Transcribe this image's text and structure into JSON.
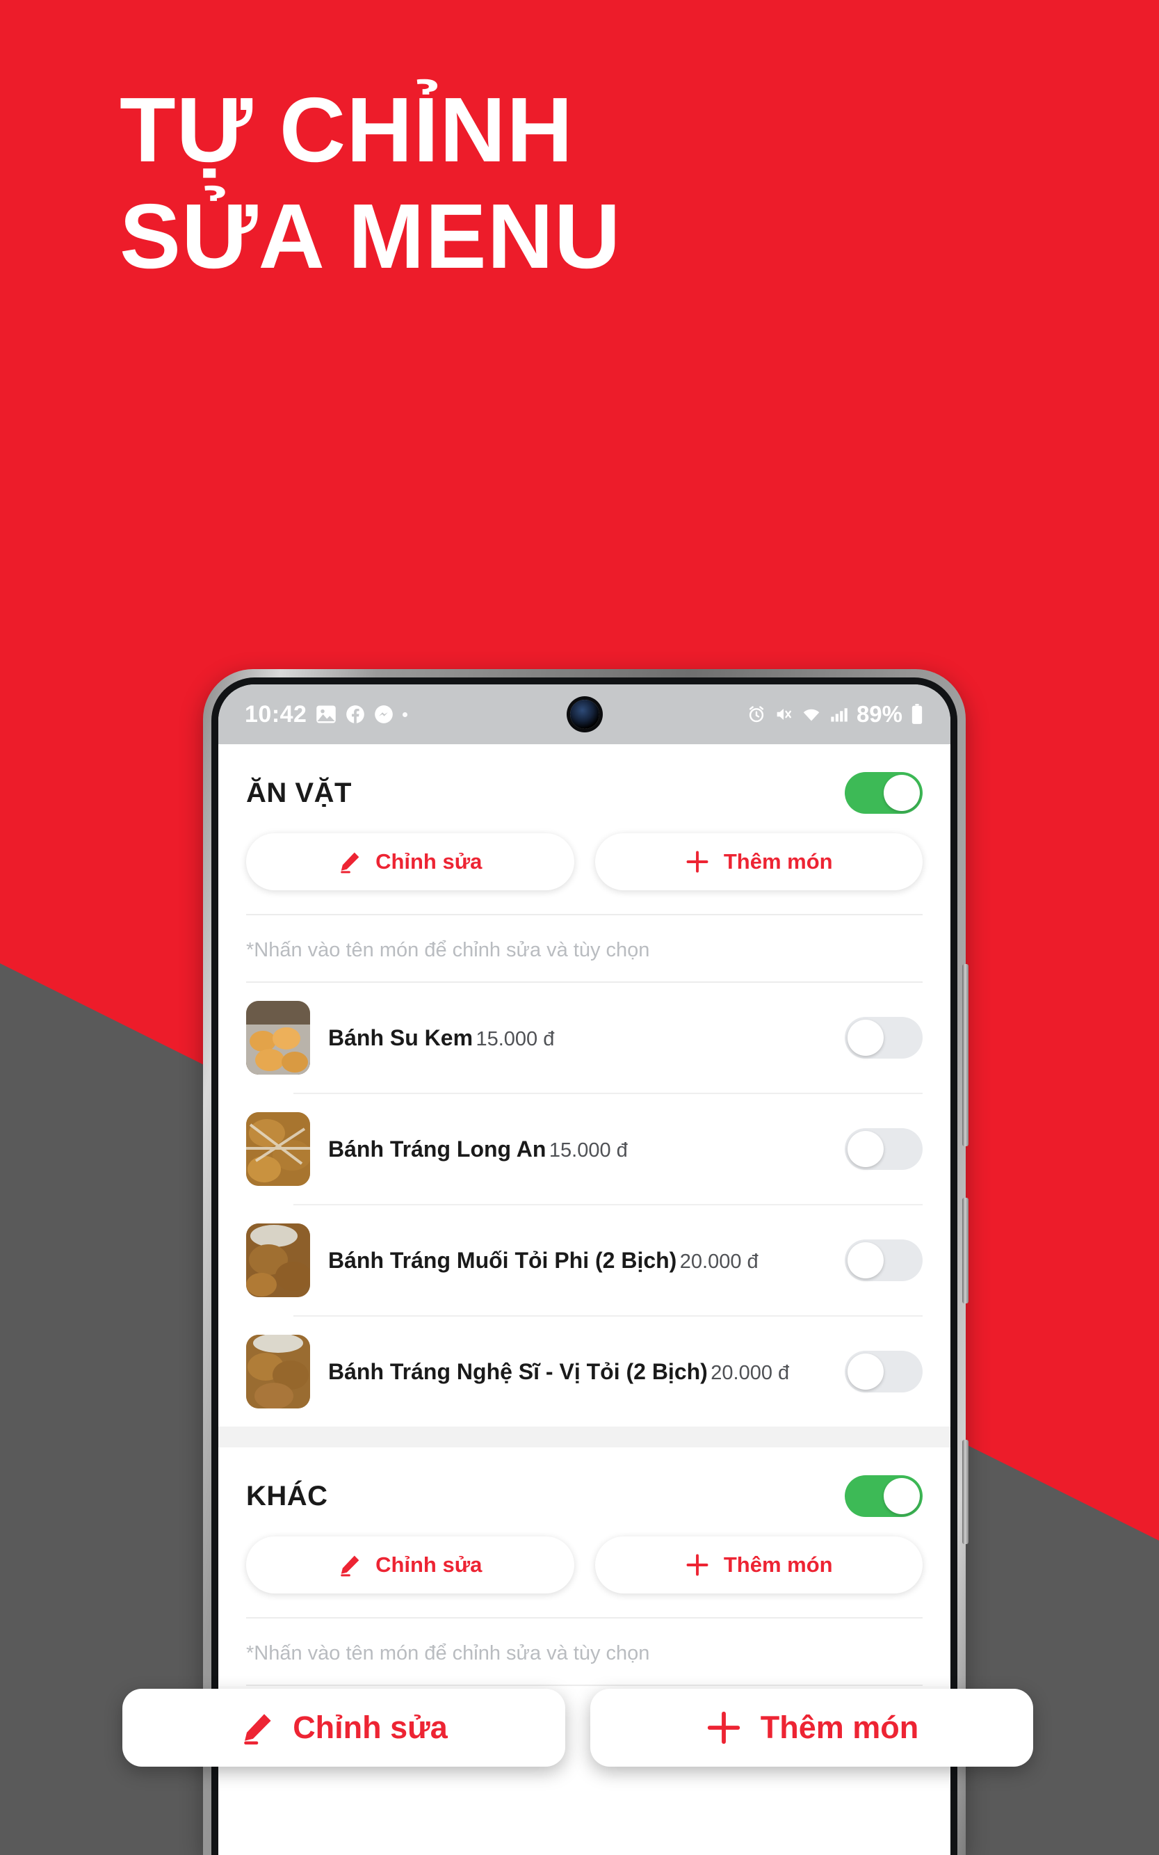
{
  "theme": {
    "red": "#ED1C2A",
    "gray": "#5A5A5A",
    "accent_red": "#ED2433",
    "toggle_on": "#3DBA56",
    "toggle_off": "#E7E9EC"
  },
  "headline": {
    "line1": "TỰ CHỈNH",
    "line2": "SỬA MENU"
  },
  "status_bar": {
    "time": "10:42",
    "battery_percent": "89%",
    "left_icons": [
      "gallery-icon",
      "facebook-icon",
      "messenger-icon",
      "dot-icon"
    ],
    "right_icons": [
      "alarm-icon",
      "mute-icon",
      "wifi-icon",
      "signal-icon",
      "battery-icon"
    ]
  },
  "app": {
    "sections": [
      {
        "title": "ĂN VẶT",
        "enabled": true,
        "edit_label": "Chỉnh sửa",
        "add_label": "Thêm món",
        "hint": "*Nhấn vào tên món để chỉnh sửa và tùy chọn",
        "items": [
          {
            "name": "Bánh Su Kem",
            "price": "15.000 đ",
            "enabled": false
          },
          {
            "name": "Bánh Tráng Long An",
            "price": "15.000 đ",
            "enabled": false
          },
          {
            "name": "Bánh Tráng Muối Tỏi Phi (2 Bịch)",
            "price": "20.000 đ",
            "enabled": false
          },
          {
            "name": "Bánh Tráng Nghệ Sĩ - Vị Tỏi (2 Bịch)",
            "price": "20.000 đ",
            "enabled": false
          }
        ]
      },
      {
        "title": "KHÁC",
        "enabled": true,
        "edit_label": "Chỉnh sửa",
        "add_label": "Thêm món",
        "hint": "*Nhấn vào tên món để chỉnh sửa và tùy chọn",
        "items": []
      }
    ]
  },
  "overlay": {
    "edit_label": "Chỉnh sửa",
    "add_label": "Thêm món"
  }
}
